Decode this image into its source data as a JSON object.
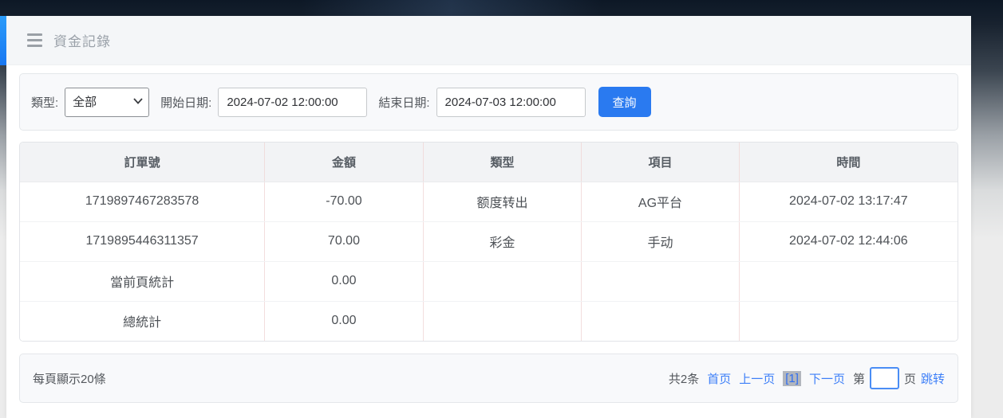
{
  "header": {
    "title": "資金記錄"
  },
  "filters": {
    "type_label": "類型:",
    "type_value": "全部",
    "start_label": "開始日期:",
    "start_value": "2024-07-02 12:00:00",
    "end_label": "結束日期:",
    "end_value": "2024-07-03 12:00:00",
    "search_button": "查詢"
  },
  "table": {
    "columns": [
      "訂單號",
      "金額",
      "類型",
      "項目",
      "時間"
    ],
    "rows": [
      [
        "1719897467283578",
        "-70.00",
        "额度转出",
        "AG平台",
        "2024-07-02 13:17:47"
      ],
      [
        "1719895446311357",
        "70.00",
        "彩金",
        "手动",
        "2024-07-02 12:44:06"
      ],
      [
        "當前頁統計",
        "0.00",
        "",
        "",
        ""
      ],
      [
        "總統計",
        "0.00",
        "",
        "",
        ""
      ]
    ]
  },
  "pagination": {
    "page_size_text": "每頁顯示20條",
    "total_text": "共2条",
    "first_label": "首页",
    "prev_label": "上一页",
    "current_page": "[1]",
    "next_label": "下一页",
    "jump_prefix": "第",
    "jump_value": "",
    "jump_suffix": "页",
    "jump_button": "跳转"
  },
  "colors": {
    "accent_blue": "#2a7af0",
    "link_blue": "#3d7ff8",
    "header_strip_blue": "#1e8bf8",
    "table_divider_pink": "#f3dede",
    "panel_grey": "#f8f9fb"
  }
}
